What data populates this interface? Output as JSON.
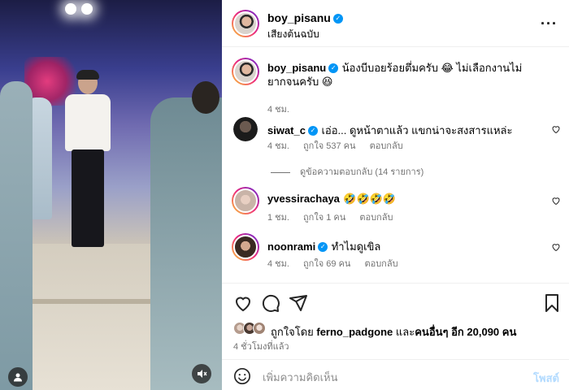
{
  "post": {
    "author": "boy_pisanu",
    "audio": "เสียงต้นฉบับ"
  },
  "caption": {
    "author": "boy_pisanu",
    "text": "น้องบีบอยร้อยตึ่มครับ 😂 ไม่เลือกงานไม่ยากจนครับ 😆",
    "time": "4 ชม."
  },
  "comments": [
    {
      "user": "siwat_c",
      "verified": true,
      "text": "เอ่อ... ดูหน้าตาแล้ว แขกน่าจะสงสารแหล่ะ",
      "time": "4 ชม.",
      "likes": "ถูกใจ 537 คน",
      "reply": "ตอบกลับ"
    },
    {
      "user": "yvessirachaya",
      "verified": false,
      "text": "🤣🤣🤣🤣",
      "time": "1 ชม.",
      "likes": "ถูกใจ 1 คน",
      "reply": "ตอบกลับ"
    },
    {
      "user": "noonrami",
      "verified": true,
      "text": "ทำไมดูเขิล",
      "time": "4 ชม.",
      "likes": "ถูกใจ 69 คน",
      "reply": "ตอบกลับ"
    }
  ],
  "view_replies": "ดูข้อความตอบกลับ (14 รายการ)",
  "liked_by": {
    "prefix": "ถูกใจโดย",
    "user": "ferno_padgone",
    "middle": "และ",
    "others": "คนอื่นๆ อีก 20,090 คน"
  },
  "posted_ago": "4 ชั่วโมงที่แล้ว",
  "comment_input": {
    "placeholder": "เพิ่มความคิดเห็น",
    "post_label": "โพสต์"
  },
  "colors": {
    "verified": "#0095f6",
    "secondary_text": "#737373",
    "post_disabled": "#b3dbff"
  },
  "icons": [
    "more-icon",
    "heart-icon",
    "comment-icon",
    "share-icon",
    "bookmark-icon",
    "emoji-icon",
    "user-tag-icon",
    "mute-icon"
  ]
}
